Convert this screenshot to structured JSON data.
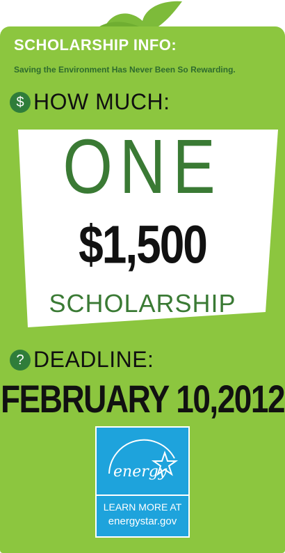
{
  "header": {
    "title": "SCHOLARSHIP INFO:",
    "tagline": "Saving the Environment Has Never Been So Rewarding."
  },
  "how_much": {
    "icon": "$",
    "label": "HOW MUCH:",
    "count": "ONE",
    "amount": "$1,500",
    "award": "SCHOLARSHIP"
  },
  "deadline": {
    "icon": "?",
    "label": "DEADLINE:",
    "date": "FEBRUARY 10,2012"
  },
  "energy_star": {
    "logo_text": "energy",
    "cta_line1": "LEARN MORE AT",
    "cta_line2": "energystar.gov"
  },
  "colors": {
    "card_green": "#8cc63f",
    "dark_green": "#3a7a34",
    "energy_blue": "#1ea3dc"
  }
}
